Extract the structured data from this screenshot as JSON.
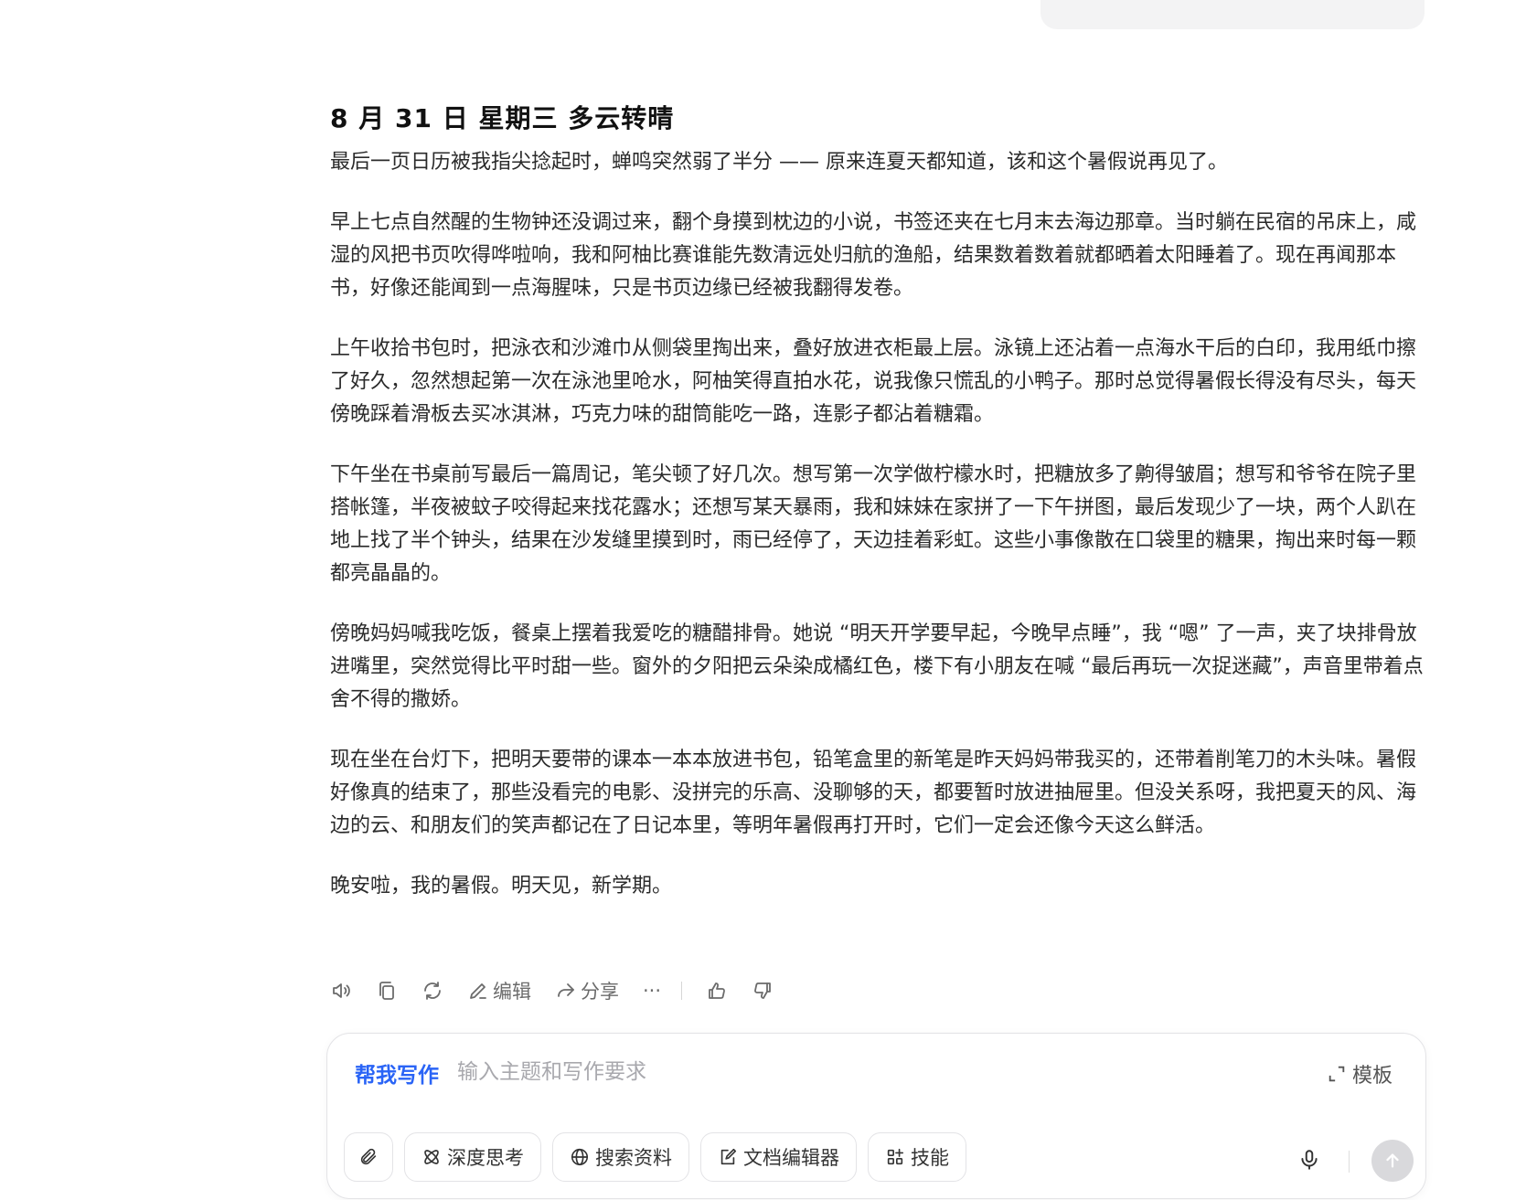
{
  "article": {
    "title": "8 月 31 日 星期三 多云转晴",
    "paragraphs": [
      "最后一页日历被我指尖捻起时，蝉鸣突然弱了半分 —— 原来连夏天都知道，该和这个暑假说再见了。",
      "早上七点自然醒的生物钟还没调过来，翻个身摸到枕边的小说，书签还夹在七月末去海边那章。当时躺在民宿的吊床上，咸湿的风把书页吹得哗啦响，我和阿柚比赛谁能先数清远处归航的渔船，结果数着数着就都晒着太阳睡着了。现在再闻那本书，好像还能闻到一点海腥味，只是书页边缘已经被我翻得发卷。",
      "上午收拾书包时，把泳衣和沙滩巾从侧袋里掏出来，叠好放进衣柜最上层。泳镜上还沾着一点海水干后的白印，我用纸巾擦了好久，忽然想起第一次在泳池里呛水，阿柚笑得直拍水花，说我像只慌乱的小鸭子。那时总觉得暑假长得没有尽头，每天傍晚踩着滑板去买冰淇淋，巧克力味的甜筒能吃一路，连影子都沾着糖霜。",
      "下午坐在书桌前写最后一篇周记，笔尖顿了好几次。想写第一次学做柠檬水时，把糖放多了齁得皱眉；想写和爷爷在院子里搭帐篷，半夜被蚊子咬得起来找花露水；还想写某天暴雨，我和妹妹在家拼了一下午拼图，最后发现少了一块，两个人趴在地上找了半个钟头，结果在沙发缝里摸到时，雨已经停了，天边挂着彩虹。这些小事像散在口袋里的糖果，掏出来时每一颗都亮晶晶的。",
      "傍晚妈妈喊我吃饭，餐桌上摆着我爱吃的糖醋排骨。她说 “明天开学要早起，今晚早点睡”，我 “嗯” 了一声，夹了块排骨放进嘴里，突然觉得比平时甜一些。窗外的夕阳把云朵染成橘红色，楼下有小朋友在喊 “最后再玩一次捉迷藏”，声音里带着点舍不得的撒娇。",
      "现在坐在台灯下，把明天要带的课本一本本放进书包，铅笔盒里的新笔是昨天妈妈带我买的，还带着削笔刀的木头味。暑假好像真的结束了，那些没看完的电影、没拼完的乐高、没聊够的天，都要暂时放进抽屉里。但没关系呀，我把夏天的风、海边的云、和朋友们的笑声都记在了日记本里，等明年暑假再打开时，它们一定会还像今天这么鲜活。",
      "晚安啦，我的暑假。明天见，新学期。"
    ]
  },
  "actions": {
    "read_aloud_icon": "speaker-icon",
    "copy_icon": "copy-icon",
    "regenerate_icon": "refresh-icon",
    "edit_label": "编辑",
    "share_label": "分享",
    "more_label": "···",
    "like_icon": "thumbs-up-icon",
    "dislike_icon": "thumbs-down-icon"
  },
  "composer": {
    "mode_label": "帮我写作",
    "placeholder": "输入主题和写作要求",
    "template_label": "模板",
    "chips": {
      "deep_think": "深度思考",
      "search": "搜索资料",
      "doc_editor": "文档编辑器",
      "skills": "技能"
    },
    "accent_color": "#2a64f6",
    "send_disabled_color": "#d9d9dc"
  }
}
